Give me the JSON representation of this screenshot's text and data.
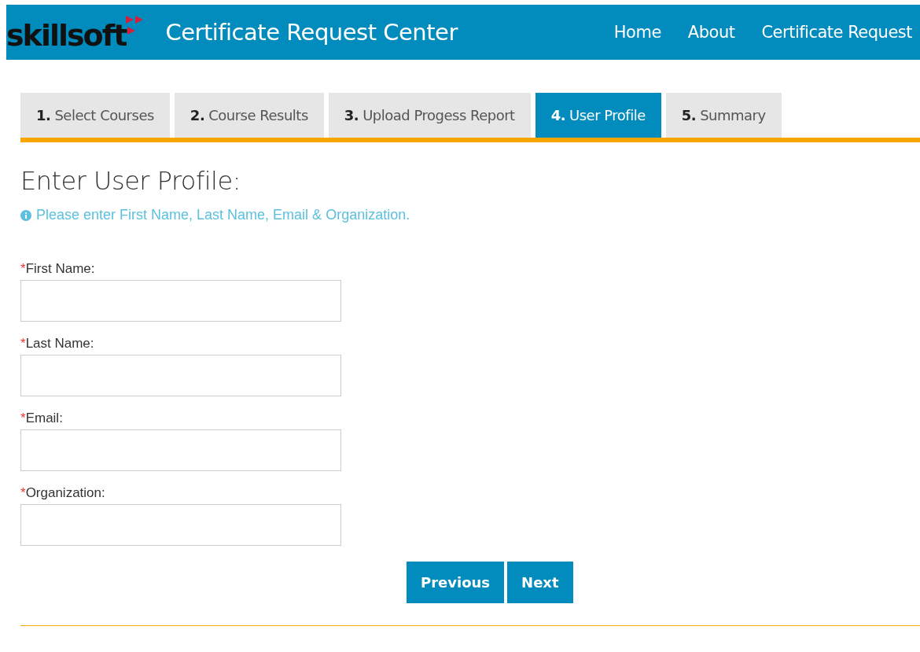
{
  "header": {
    "logo": "skillsoft",
    "title": "Certificate Request Center",
    "nav": [
      {
        "label": "Home"
      },
      {
        "label": "About"
      },
      {
        "label": "Certificate Request"
      }
    ]
  },
  "tabs": [
    {
      "number": "1.",
      "label": "Select Courses",
      "selected": false
    },
    {
      "number": "2.",
      "label": "Course Results",
      "selected": false
    },
    {
      "number": "3.",
      "label": "Upload Progess Report",
      "selected": false
    },
    {
      "number": "4.",
      "label": "User Profile",
      "selected": true
    },
    {
      "number": "5.",
      "label": "Summary",
      "selected": false
    }
  ],
  "heading": "Enter User Profile:",
  "info": "Please enter First Name, Last Name, Email & Organization.",
  "fields": [
    {
      "required_mark": "*",
      "label": "First Name:"
    },
    {
      "required_mark": "*",
      "label": "Last Name:"
    },
    {
      "required_mark": "*",
      "label": "Email:"
    },
    {
      "required_mark": "*",
      "label": "Organization:"
    }
  ],
  "buttons": [
    {
      "label": "Previous"
    },
    {
      "label": "Next"
    }
  ]
}
